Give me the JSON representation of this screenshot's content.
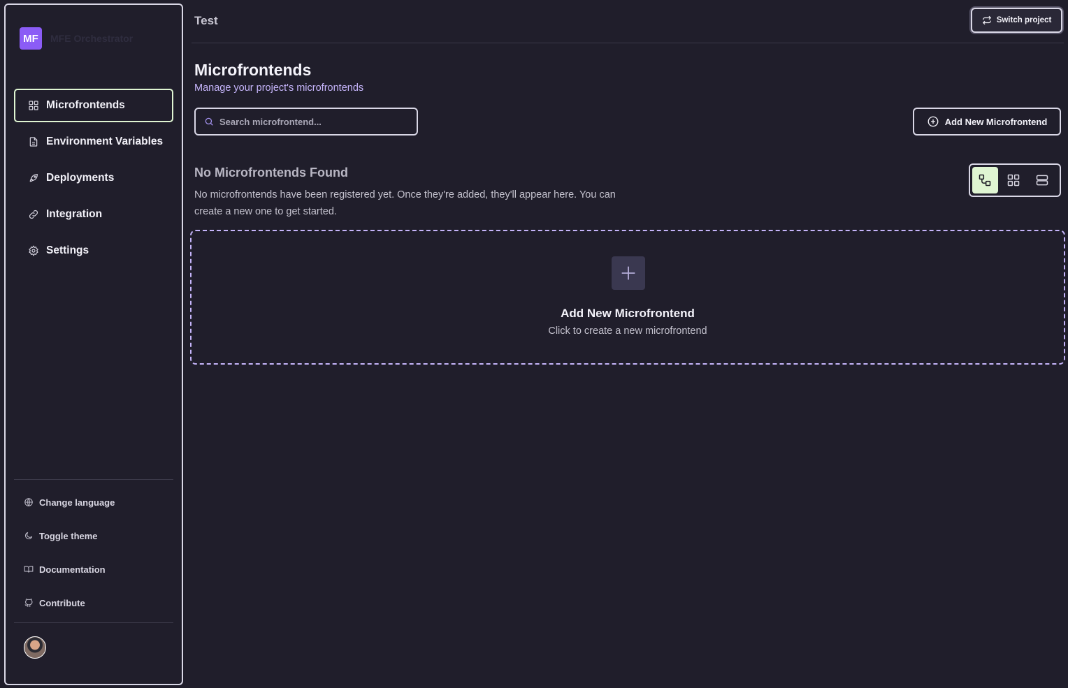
{
  "sidebar": {
    "brand_logo": "MF",
    "brand_name": "MFE Orchestrator",
    "nav": [
      {
        "label": "Microfrontends",
        "icon": "grid-icon",
        "active": true
      },
      {
        "label": "Environment Variables",
        "icon": "file-text-icon",
        "active": false
      },
      {
        "label": "Deployments",
        "icon": "rocket-icon",
        "active": false
      },
      {
        "label": "Integration",
        "icon": "link-icon",
        "active": false
      },
      {
        "label": "Settings",
        "icon": "gear-icon",
        "active": false
      }
    ],
    "utilities": [
      {
        "label": "Change language",
        "icon": "globe-icon"
      },
      {
        "label": "Toggle theme",
        "icon": "moon-icon"
      },
      {
        "label": "Documentation",
        "icon": "book-icon"
      },
      {
        "label": "Contribute",
        "icon": "git-icon"
      }
    ]
  },
  "topbar": {
    "project_name": "Test",
    "switch_label": "Switch project"
  },
  "main": {
    "title": "Microfrontends",
    "subtitle": "Manage your project's microfrontends",
    "search_placeholder": "Search microfrontend...",
    "add_label": "Add New Microfrontend",
    "empty_title": "No Microfrontends Found",
    "empty_desc": "No microfrontends have been registered yet. Once they're added, they'll appear here. You can create a new one to get started.",
    "dropzone_title": "Add New Microfrontend",
    "dropzone_sub": "Click to create a new microfrontend",
    "views": [
      {
        "icon": "flow-view-icon",
        "active": true
      },
      {
        "icon": "grid-view-icon",
        "active": false
      },
      {
        "icon": "list-view-icon",
        "active": false
      }
    ]
  },
  "colors": {
    "background": "#201e2b",
    "accent_purple": "#c6b5fb",
    "accent_green": "#dff5d2",
    "brand": "#8b5cf6"
  }
}
